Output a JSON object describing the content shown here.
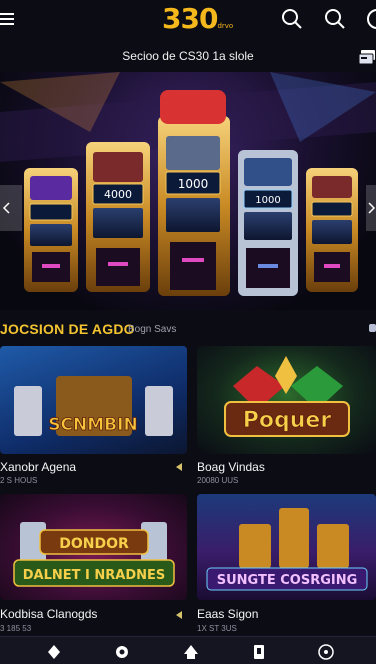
{
  "header": {
    "logo_text": "330",
    "logo_small": "drvo",
    "icons": [
      "menu-icon",
      "search-icon",
      "search-icon",
      "profile-icon"
    ]
  },
  "subbar": {
    "text": "Secioo de CS30 1a slole",
    "icon": "card-icon"
  },
  "banner": {
    "machines": [
      "4000",
      "1000",
      "1000"
    ],
    "icons": [
      "chevron-left-icon",
      "chevron-right-icon"
    ]
  },
  "section": {
    "title": "JOCSION DE AGDO",
    "subtitle": "Bogn Savs"
  },
  "cards": [
    {
      "art_text": "SCNMBIN",
      "title": "Xanobr Agena",
      "sub": "2 S HOUS"
    },
    {
      "art_text": "Poquer",
      "title": "Boag Vindas",
      "sub": "20080 UUS"
    },
    {
      "art_text": "DONDOR DALNET I NRADNES",
      "title": "Kodbisa Clanogds",
      "sub": "3 185 53"
    },
    {
      "art_text": "SUNGTE COSRGING",
      "title": "Eaas Sigon",
      "sub": "1X ST 3US"
    }
  ],
  "bottom_nav": [
    "diamond-icon",
    "chip-icon",
    "home-icon",
    "slot-icon",
    "account-icon"
  ],
  "colors": {
    "accent": "#f4b81c",
    "background": "#0b0c14",
    "nav": "#141520"
  }
}
